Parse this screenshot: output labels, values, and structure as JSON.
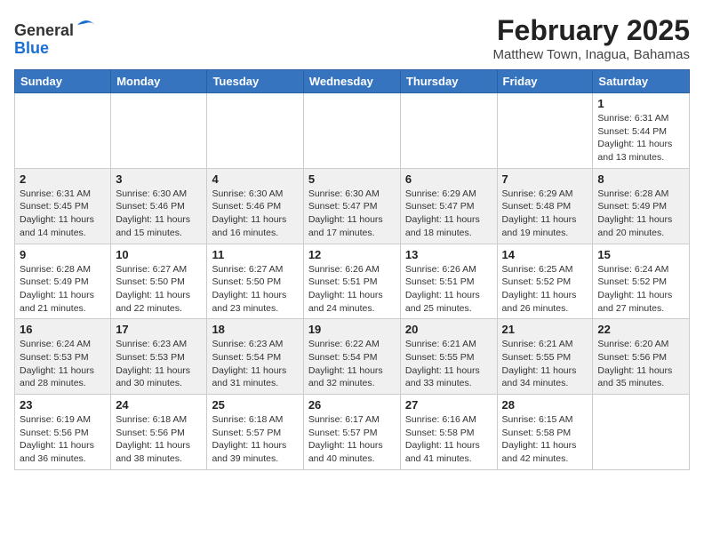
{
  "header": {
    "logo_general": "General",
    "logo_blue": "Blue",
    "month_title": "February 2025",
    "subtitle": "Matthew Town, Inagua, Bahamas"
  },
  "days_of_week": [
    "Sunday",
    "Monday",
    "Tuesday",
    "Wednesday",
    "Thursday",
    "Friday",
    "Saturday"
  ],
  "weeks": [
    [
      {
        "day": "",
        "info": ""
      },
      {
        "day": "",
        "info": ""
      },
      {
        "day": "",
        "info": ""
      },
      {
        "day": "",
        "info": ""
      },
      {
        "day": "",
        "info": ""
      },
      {
        "day": "",
        "info": ""
      },
      {
        "day": "1",
        "info": "Sunrise: 6:31 AM\nSunset: 5:44 PM\nDaylight: 11 hours and 13 minutes."
      }
    ],
    [
      {
        "day": "2",
        "info": "Sunrise: 6:31 AM\nSunset: 5:45 PM\nDaylight: 11 hours and 14 minutes."
      },
      {
        "day": "3",
        "info": "Sunrise: 6:30 AM\nSunset: 5:46 PM\nDaylight: 11 hours and 15 minutes."
      },
      {
        "day": "4",
        "info": "Sunrise: 6:30 AM\nSunset: 5:46 PM\nDaylight: 11 hours and 16 minutes."
      },
      {
        "day": "5",
        "info": "Sunrise: 6:30 AM\nSunset: 5:47 PM\nDaylight: 11 hours and 17 minutes."
      },
      {
        "day": "6",
        "info": "Sunrise: 6:29 AM\nSunset: 5:47 PM\nDaylight: 11 hours and 18 minutes."
      },
      {
        "day": "7",
        "info": "Sunrise: 6:29 AM\nSunset: 5:48 PM\nDaylight: 11 hours and 19 minutes."
      },
      {
        "day": "8",
        "info": "Sunrise: 6:28 AM\nSunset: 5:49 PM\nDaylight: 11 hours and 20 minutes."
      }
    ],
    [
      {
        "day": "9",
        "info": "Sunrise: 6:28 AM\nSunset: 5:49 PM\nDaylight: 11 hours and 21 minutes."
      },
      {
        "day": "10",
        "info": "Sunrise: 6:27 AM\nSunset: 5:50 PM\nDaylight: 11 hours and 22 minutes."
      },
      {
        "day": "11",
        "info": "Sunrise: 6:27 AM\nSunset: 5:50 PM\nDaylight: 11 hours and 23 minutes."
      },
      {
        "day": "12",
        "info": "Sunrise: 6:26 AM\nSunset: 5:51 PM\nDaylight: 11 hours and 24 minutes."
      },
      {
        "day": "13",
        "info": "Sunrise: 6:26 AM\nSunset: 5:51 PM\nDaylight: 11 hours and 25 minutes."
      },
      {
        "day": "14",
        "info": "Sunrise: 6:25 AM\nSunset: 5:52 PM\nDaylight: 11 hours and 26 minutes."
      },
      {
        "day": "15",
        "info": "Sunrise: 6:24 AM\nSunset: 5:52 PM\nDaylight: 11 hours and 27 minutes."
      }
    ],
    [
      {
        "day": "16",
        "info": "Sunrise: 6:24 AM\nSunset: 5:53 PM\nDaylight: 11 hours and 28 minutes."
      },
      {
        "day": "17",
        "info": "Sunrise: 6:23 AM\nSunset: 5:53 PM\nDaylight: 11 hours and 30 minutes."
      },
      {
        "day": "18",
        "info": "Sunrise: 6:23 AM\nSunset: 5:54 PM\nDaylight: 11 hours and 31 minutes."
      },
      {
        "day": "19",
        "info": "Sunrise: 6:22 AM\nSunset: 5:54 PM\nDaylight: 11 hours and 32 minutes."
      },
      {
        "day": "20",
        "info": "Sunrise: 6:21 AM\nSunset: 5:55 PM\nDaylight: 11 hours and 33 minutes."
      },
      {
        "day": "21",
        "info": "Sunrise: 6:21 AM\nSunset: 5:55 PM\nDaylight: 11 hours and 34 minutes."
      },
      {
        "day": "22",
        "info": "Sunrise: 6:20 AM\nSunset: 5:56 PM\nDaylight: 11 hours and 35 minutes."
      }
    ],
    [
      {
        "day": "23",
        "info": "Sunrise: 6:19 AM\nSunset: 5:56 PM\nDaylight: 11 hours and 36 minutes."
      },
      {
        "day": "24",
        "info": "Sunrise: 6:18 AM\nSunset: 5:56 PM\nDaylight: 11 hours and 38 minutes."
      },
      {
        "day": "25",
        "info": "Sunrise: 6:18 AM\nSunset: 5:57 PM\nDaylight: 11 hours and 39 minutes."
      },
      {
        "day": "26",
        "info": "Sunrise: 6:17 AM\nSunset: 5:57 PM\nDaylight: 11 hours and 40 minutes."
      },
      {
        "day": "27",
        "info": "Sunrise: 6:16 AM\nSunset: 5:58 PM\nDaylight: 11 hours and 41 minutes."
      },
      {
        "day": "28",
        "info": "Sunrise: 6:15 AM\nSunset: 5:58 PM\nDaylight: 11 hours and 42 minutes."
      },
      {
        "day": "",
        "info": ""
      }
    ]
  ]
}
